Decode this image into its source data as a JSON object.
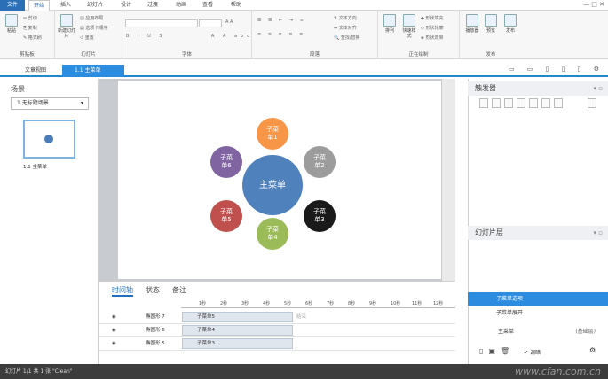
{
  "ribbon_tabs": [
    "文件",
    "开始",
    "插入",
    "幻灯片",
    "设计",
    "过渡",
    "动画",
    "查看",
    "帮助"
  ],
  "window_buttons": "— □ ✕",
  "clipboard": {
    "paste": "粘贴",
    "cut": "剪切",
    "copy": "复制",
    "format_painter": "格式刷",
    "label": "剪贴板"
  },
  "slides_group": {
    "new_slide": "新建幻灯片",
    "apply_layout": "应用布局",
    "tab_order": "选项卡顺序",
    "reset": "重置",
    "label": "幻灯片"
  },
  "font_group": {
    "label": "字体",
    "buttons": [
      "B",
      "I",
      "U",
      "S",
      "abc",
      "A",
      "A"
    ]
  },
  "paragraph_group": {
    "label": "段落",
    "text_direction": "文本方向",
    "text_align": "文本对齐",
    "find_replace": "查找/替换"
  },
  "drawing_group": {
    "label": "正在绘制",
    "arrange": "排列",
    "quick_styles": "快速样式",
    "shape_fill": "形状填充",
    "shape_outline": "形状轮廓",
    "shape_effect": "形状效果"
  },
  "publish_group": {
    "label": "发布",
    "player": "播放器",
    "preview": "预览",
    "publish": "发布"
  },
  "doc_tabs": [
    {
      "label": "文章视图"
    },
    {
      "label": "1.1 主菜单"
    }
  ],
  "view_icons": "▭ ▭ ▯ ▯ ▯ ⚙",
  "left_panel": {
    "title": "场景",
    "scene_select": "1 无标题场景",
    "slide_caption": "1.1 主菜单"
  },
  "slide_shapes": [
    {
      "label": "主菜单",
      "color": "#4f81bd"
    },
    {
      "label": "子菜\n单1",
      "color": "#f79646"
    },
    {
      "label": "子菜\n单2",
      "color": "#9c9c9c"
    },
    {
      "label": "子菜\n单3",
      "color": "#1a1a1a"
    },
    {
      "label": "子菜\n单4",
      "color": "#9bbb59"
    },
    {
      "label": "子菜\n单5",
      "color": "#c0504d"
    },
    {
      "label": "子菜\n单6",
      "color": "#8064a2"
    }
  ],
  "timeline": {
    "tabs": [
      "时间轴",
      "状态",
      "备注"
    ],
    "ruler": [
      "1秒",
      "2秒",
      "3秒",
      "4秒",
      "5秒",
      "6秒",
      "7秒",
      "8秒",
      "9秒",
      "10秒",
      "11秒",
      "12秒"
    ],
    "end_label": "结束",
    "rows": [
      {
        "name": "椭圆形 7",
        "bar": "子菜单5"
      },
      {
        "name": "椭圆形 6",
        "bar": "子菜单4"
      },
      {
        "name": "椭圆形 5",
        "bar": "子菜单3"
      }
    ]
  },
  "right_panel": {
    "triggers_title": "触发器",
    "layers_title": "幻灯片层",
    "layers": [
      {
        "label": "子菜单选项",
        "selected": true
      },
      {
        "label": "子菜单展开",
        "selected": false
      }
    ],
    "base_layer": "主菜单",
    "base_tag": "(基础层)",
    "dim_label": "调暗"
  },
  "status": {
    "text": "幻灯片 1/1 共 1 张  \"Clean\"",
    "watermark": "www.cfan.com.cn"
  }
}
